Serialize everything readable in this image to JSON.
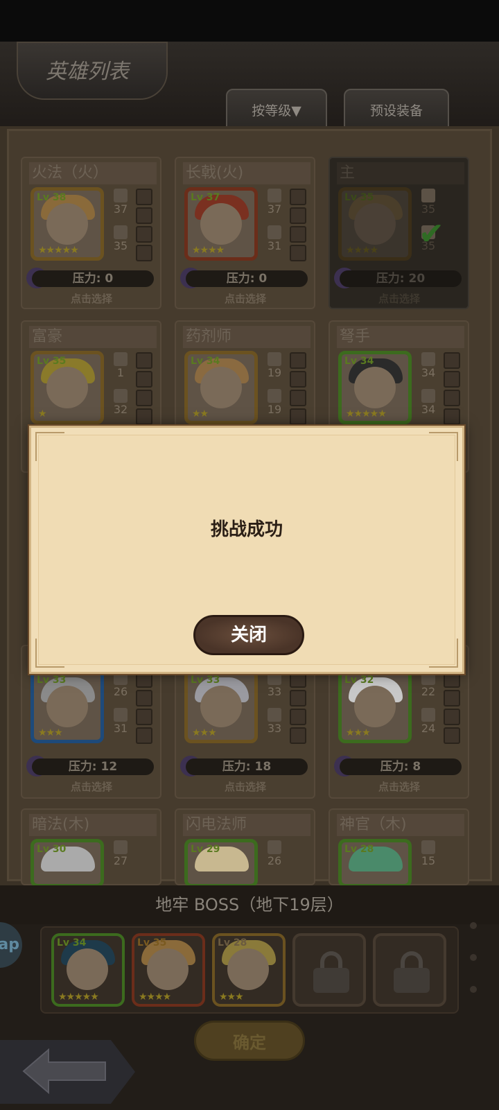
{
  "header": {
    "title": "英雄列表"
  },
  "tabs": [
    "按等级▼",
    "预设装备"
  ],
  "heroes": [
    {
      "name": "火法（火）",
      "lv": "Lv 38",
      "stars": "★★★★★",
      "atk": "37",
      "def": "35",
      "pressure": "压力: 0",
      "choose": "点击选择"
    },
    {
      "name": "长戟(火)",
      "lv": "Lv 37",
      "stars": "★★★★",
      "atk": "37",
      "def": "31",
      "pressure": "压力: 0",
      "choose": "点击选择"
    },
    {
      "name": "主",
      "lv": "Lv 35",
      "stars": "★★★★",
      "atk": "35",
      "def": "35",
      "pressure": "压力: 20",
      "choose": "点击选择"
    },
    {
      "name": "富豪",
      "lv": "Lv 35",
      "stars": "★",
      "atk": "1",
      "def": "32"
    },
    {
      "name": "药剂师",
      "lv": "Lv 34",
      "stars": "★★",
      "atk": "19",
      "def": "19"
    },
    {
      "name": "弩手",
      "lv": "Lv 34",
      "stars": "★★★★★",
      "atk": "34",
      "def": "34"
    },
    {
      "lv": "Lv 33",
      "stars": "★★★",
      "atk": "26",
      "def": "31",
      "pressure": "压力: 12",
      "choose": "点击选择"
    },
    {
      "lv": "Lv 33",
      "stars": "★★★",
      "atk": "33",
      "def": "33",
      "pressure": "压力: 18",
      "choose": "点击选择"
    },
    {
      "lv": "Lv 32",
      "stars": "★★★",
      "atk": "22",
      "def": "24",
      "pressure": "压力: 8",
      "choose": "点击选择"
    },
    {
      "name": "暗法(木)",
      "lv": "Lv 30",
      "atk": "27"
    },
    {
      "name": "闪电法师",
      "lv": "Lv 29",
      "atk": "26"
    },
    {
      "name": "神官（木)",
      "lv": "Lv 28",
      "atk": "15"
    }
  ],
  "stage": "地牢 BOSS（地下19层）",
  "team": [
    {
      "lv": "Lv 34",
      "stars": "★★★★★"
    },
    {
      "lv": "Lv 35",
      "stars": "★★★★"
    },
    {
      "lv": "Lv 28",
      "stars": "★★★"
    }
  ],
  "confirm_label": "确定",
  "app_badge": "ap",
  "dialog": {
    "message": "挑战成功",
    "close_label": "关闭"
  }
}
